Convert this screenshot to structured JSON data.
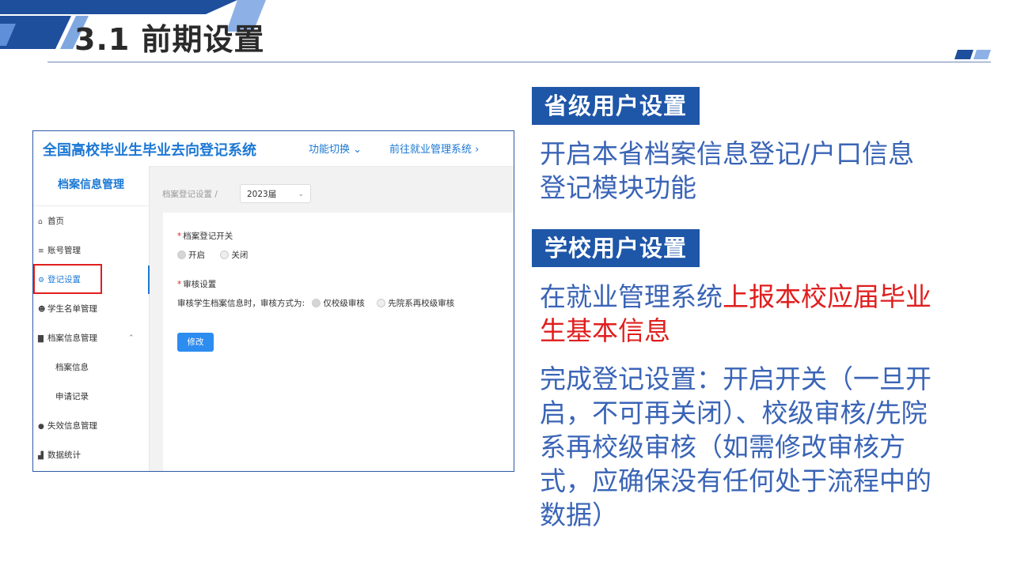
{
  "slide": {
    "title": "3.1 前期设置"
  },
  "shot": {
    "system_title": "全国高校毕业生毕业去向登记系统",
    "switch_link": "功能切换 ⌄",
    "goto_link": "前往就业管理系统 ›",
    "sidebar": {
      "header": "档案信息管理",
      "items": [
        {
          "icon": "home-icon",
          "glyph": "⌂",
          "label": "首页"
        },
        {
          "icon": "list-icon",
          "glyph": "≡",
          "label": "账号管理"
        },
        {
          "icon": "gear-icon",
          "glyph": "⚙",
          "label": "登记设置"
        },
        {
          "icon": "students-icon",
          "glyph": "☻",
          "label": "学生名单管理"
        },
        {
          "icon": "archive-icon",
          "glyph": "▇",
          "label": "档案信息管理"
        },
        {
          "label": "档案信息"
        },
        {
          "label": "申请记录"
        },
        {
          "icon": "circle-icon",
          "glyph": "●",
          "label": "失效信息管理"
        },
        {
          "icon": "chart-icon",
          "glyph": "▟",
          "label": "数据统计"
        }
      ],
      "active": "登记设置",
      "expanded_caret": "⌃"
    },
    "breadcrumb": "档案登记设置  /",
    "year_select": {
      "value": "2023届",
      "chevron": "⌄"
    },
    "form": {
      "switch_label": "档案登记开关",
      "switch_options": [
        "开启",
        "关闭"
      ],
      "switch_selected": "开启",
      "review_label": "审核设置",
      "review_prompt": "审核学生档案信息时，审核方式为:",
      "review_options": [
        "仅校级审核",
        "先院系再校级审核"
      ],
      "review_selected": "仅校级审核",
      "required_mark": "*",
      "edit_button": "修改"
    }
  },
  "right": {
    "section1_label": "省级用户设置",
    "section1_text": "开启本省档案信息登记/户口信息登记模块功能",
    "section2_label": "学校用户设置",
    "section2_text_a": "在就业管理系统",
    "section2_text_red": "上报本校应届毕业生基本信息",
    "section2_text_b": "完成登记设置：开启开关（一旦开启，不可再关闭）、校级审核/先院系再校级审核（如需修改审核方式，应确保没有任何处于流程中的数据）"
  },
  "colors": {
    "accent_blue": "#1e56a8",
    "text_blue": "#3a64b6",
    "link_blue": "#1c78d4",
    "highlight_red": "#e01e1e"
  }
}
